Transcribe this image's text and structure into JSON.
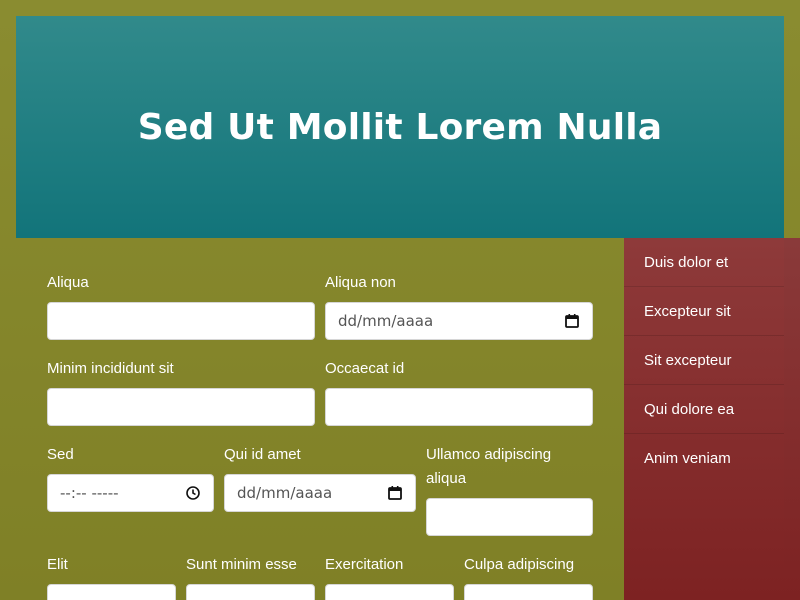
{
  "header": {
    "title": "Sed Ut Mollit Lorem Nulla"
  },
  "form": {
    "row1": [
      {
        "label": "Aliqua",
        "value": ""
      },
      {
        "label": "Aliqua non",
        "placeholder": "dd/mm/aaaa"
      }
    ],
    "row2": [
      {
        "label": "Minim incididunt sit",
        "value": ""
      },
      {
        "label": "Occaecat id",
        "value": ""
      }
    ],
    "row3": [
      {
        "label": "Sed",
        "placeholder": "--:-- -----"
      },
      {
        "label": "Qui id amet",
        "placeholder": "dd/mm/aaaa"
      },
      {
        "label": "Ullamco adipiscing aliqua",
        "value": ""
      }
    ],
    "row4": [
      {
        "label": "Elit"
      },
      {
        "label": "Sunt minim esse"
      },
      {
        "label": "Exercitation"
      },
      {
        "label": "Culpa adipiscing"
      }
    ]
  },
  "sidebar": {
    "items": [
      {
        "label": "Duis dolor et"
      },
      {
        "label": "Excepteur sit"
      },
      {
        "label": "Sit excepteur"
      },
      {
        "label": "Qui dolore ea"
      },
      {
        "label": "Anim veniam"
      }
    ]
  },
  "icons": {
    "date": "calendar-icon",
    "time": "clock-icon"
  }
}
